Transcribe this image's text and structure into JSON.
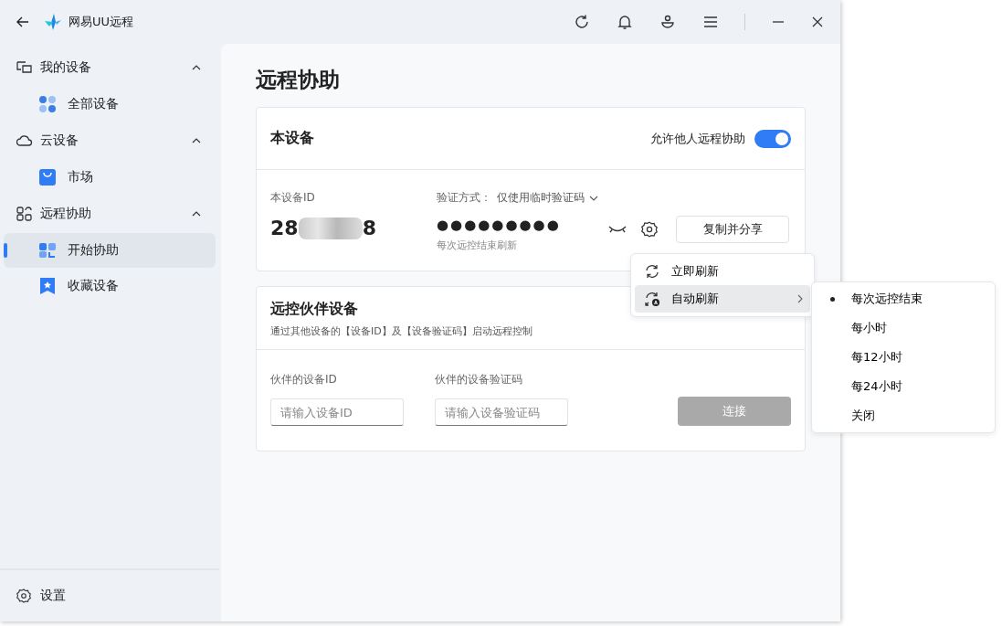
{
  "app": {
    "title": "网易UU远程"
  },
  "sidebar": {
    "groups": [
      {
        "label": "我的设备",
        "expanded": true,
        "children": [
          {
            "label": "全部设备",
            "selected": false
          }
        ]
      },
      {
        "label": "云设备",
        "expanded": true,
        "children": [
          {
            "label": "市场",
            "selected": false
          }
        ]
      },
      {
        "label": "远程协助",
        "expanded": true,
        "children": [
          {
            "label": "开始协助",
            "selected": true
          },
          {
            "label": "收藏设备",
            "selected": false
          }
        ]
      }
    ],
    "footer": {
      "label": "设置"
    }
  },
  "page": {
    "title": "远程协助"
  },
  "this_device": {
    "title": "本设备",
    "allow_label": "允许他人远程协助",
    "allow_on": true,
    "id_label": "本设备ID",
    "id_start": "28",
    "id_end": "8",
    "verify_label": "验证方式：",
    "verify_mode": "仅使用临时验证码",
    "code_mask": "●●●●●●●●●",
    "code_hint": "每次远控结束刷新",
    "share_button": "复制并分享"
  },
  "refresh_menu": {
    "items": [
      {
        "label": "立即刷新",
        "kind": "action",
        "highlighted": false
      },
      {
        "label": "自动刷新",
        "kind": "submenu",
        "highlighted": true
      }
    ]
  },
  "auto_refresh_menu": {
    "items": [
      {
        "label": "每次远控结束",
        "selected": true
      },
      {
        "label": "每小时",
        "selected": false
      },
      {
        "label": "每12小时",
        "selected": false
      },
      {
        "label": "每24小时",
        "selected": false
      },
      {
        "label": "关闭",
        "selected": false
      }
    ]
  },
  "partner": {
    "title": "远控伙伴设备",
    "description": "通过其他设备的【设备ID】及【设备验证码】启动远程控制",
    "id_label": "伙伴的设备ID",
    "id_placeholder": "请输入设备ID",
    "code_label": "伙伴的设备验证码",
    "code_placeholder": "请输入设备验证码",
    "connect_button": "连接",
    "connect_disabled": true
  }
}
